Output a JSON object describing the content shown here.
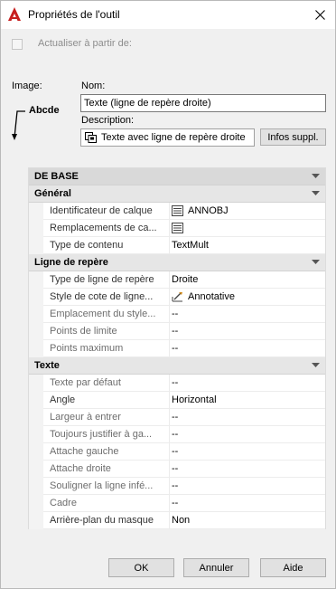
{
  "window": {
    "title": "Propriétés de l'outil",
    "accent_color": "#c71f1f"
  },
  "update_checkbox": {
    "label": "Actualiser à partir de:",
    "checked": false
  },
  "image": {
    "label": "Image:",
    "preview_text": "Abcde"
  },
  "nom": {
    "label": "Nom:",
    "value": "Texte (ligne de repère droite)"
  },
  "description": {
    "label": "Description:",
    "value": "Texte avec ligne de repère droite",
    "icon": "multileader-icon"
  },
  "buttons": {
    "infos": "Infos suppl.",
    "ok": "OK",
    "annuler": "Annuler",
    "aide": "Aide"
  },
  "grid": {
    "top_category": "DE BASE",
    "sections": [
      {
        "title": "Général",
        "rows": [
          {
            "name": "Identificateur de calque",
            "value": "ANNOBJ",
            "icon": "layer-list-icon"
          },
          {
            "name": "Remplacements de ca...",
            "value": "",
            "icon": "layer-list-icon"
          },
          {
            "name": "Type de contenu",
            "value": "TextMult",
            "icon": ""
          }
        ]
      },
      {
        "title": "Ligne de repère",
        "rows": [
          {
            "name": "Type de ligne de repère",
            "value": "Droite",
            "icon": ""
          },
          {
            "name": "Style de cote de ligne...",
            "value": "Annotative",
            "icon": "annotative-style-icon"
          },
          {
            "name": "Emplacement du style...",
            "value": "--",
            "icon": ""
          },
          {
            "name": "Points de limite",
            "value": "--",
            "icon": ""
          },
          {
            "name": "Points maximum",
            "value": "--",
            "icon": ""
          }
        ]
      },
      {
        "title": "Texte",
        "rows": [
          {
            "name": "Texte par défaut",
            "value": "--",
            "icon": ""
          },
          {
            "name": "Angle",
            "value": "Horizontal",
            "icon": ""
          },
          {
            "name": "Largeur à entrer",
            "value": "--",
            "icon": ""
          },
          {
            "name": "Toujours justifier à ga...",
            "value": "--",
            "icon": ""
          },
          {
            "name": "Attache gauche",
            "value": "--",
            "icon": ""
          },
          {
            "name": "Attache droite",
            "value": "--",
            "icon": ""
          },
          {
            "name": "Souligner la ligne infé...",
            "value": "--",
            "icon": ""
          },
          {
            "name": "Cadre",
            "value": "--",
            "icon": ""
          },
          {
            "name": "Arrière-plan du masque",
            "value": "Non",
            "icon": ""
          }
        ]
      }
    ]
  }
}
